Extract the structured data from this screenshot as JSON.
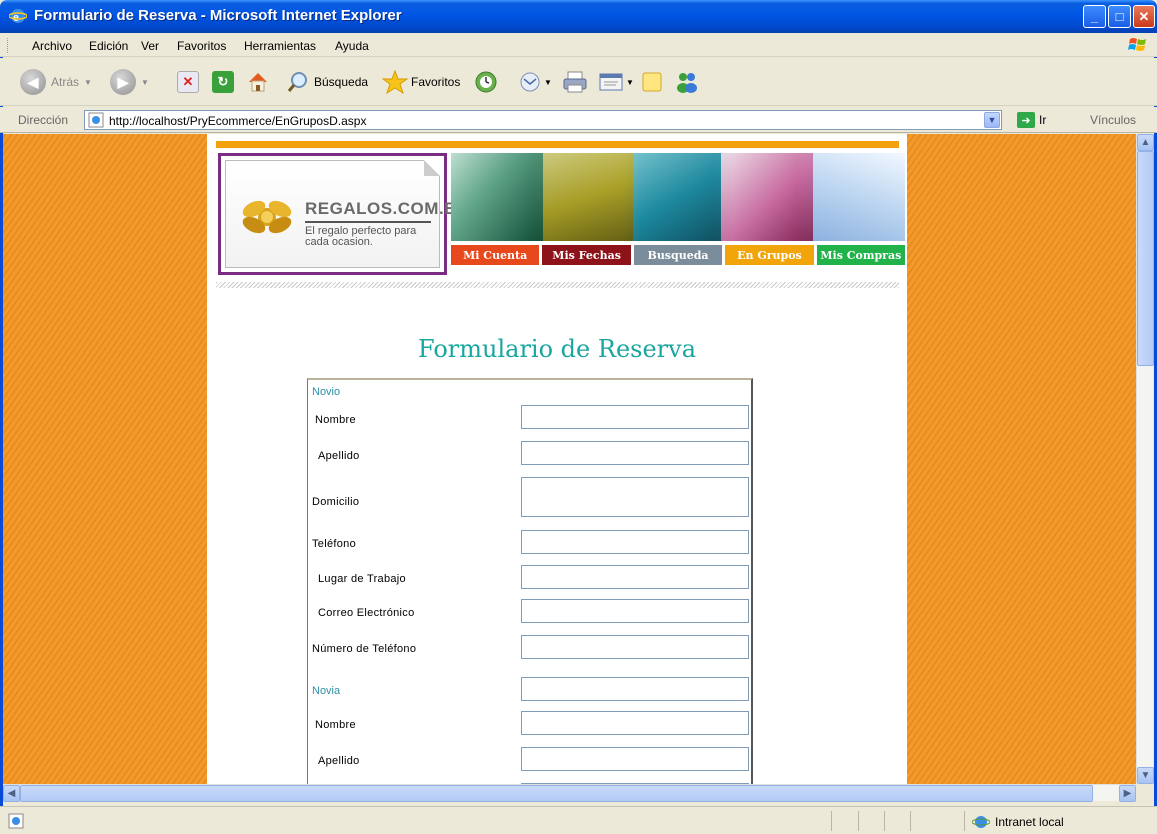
{
  "window": {
    "title": "Formulario de Reserva - Microsoft Internet Explorer",
    "controls": {
      "minimize": "_",
      "maximize": "□",
      "close": "✕"
    }
  },
  "menu": [
    "Archivo",
    "Edición",
    "Ver",
    "Favoritos",
    "Herramientas",
    "Ayuda"
  ],
  "toolbar": {
    "back": "Atrás",
    "search": "Búsqueda",
    "favorites": "Favoritos"
  },
  "address": {
    "label": "Dirección",
    "url": "http://localhost/PryEcommerce/EnGruposD.aspx",
    "go": "Ir",
    "links": "Vínculos"
  },
  "site": {
    "brand": "REGALOS.COM.EC",
    "tagline_1": "El regalo perfecto para",
    "tagline_2": "cada ocasion.",
    "nav": [
      {
        "label": "Mi Cuenta",
        "color": "#e8491c"
      },
      {
        "label": "Mis Fechas",
        "color": "#8e1219"
      },
      {
        "label": "Busqueda",
        "color": "#7b8d9a"
      },
      {
        "label": "En Grupos",
        "color": "#f2a50b"
      },
      {
        "label": "Mis Compras",
        "color": "#21b24a"
      }
    ]
  },
  "form": {
    "title": "Formulario de Reserva",
    "novio_section": "Novio",
    "novio_fields": [
      "Nombre",
      "Apellido",
      "Domicilio",
      "Teléfono",
      "Lugar de Trabajo",
      "Correo Electrónico",
      "Número de Teléfono"
    ],
    "novia_section": "Novia",
    "novia_fields": [
      "Nombre",
      "Apellido"
    ]
  },
  "status": {
    "zone": "Intranet local"
  },
  "colors": {
    "title_teal": "#1aa6a0",
    "section_blue": "#2f8fa8",
    "background_orange": "#f39a2b",
    "accent_bar": "#f3a10d",
    "logo_border": "#7a2b82"
  }
}
